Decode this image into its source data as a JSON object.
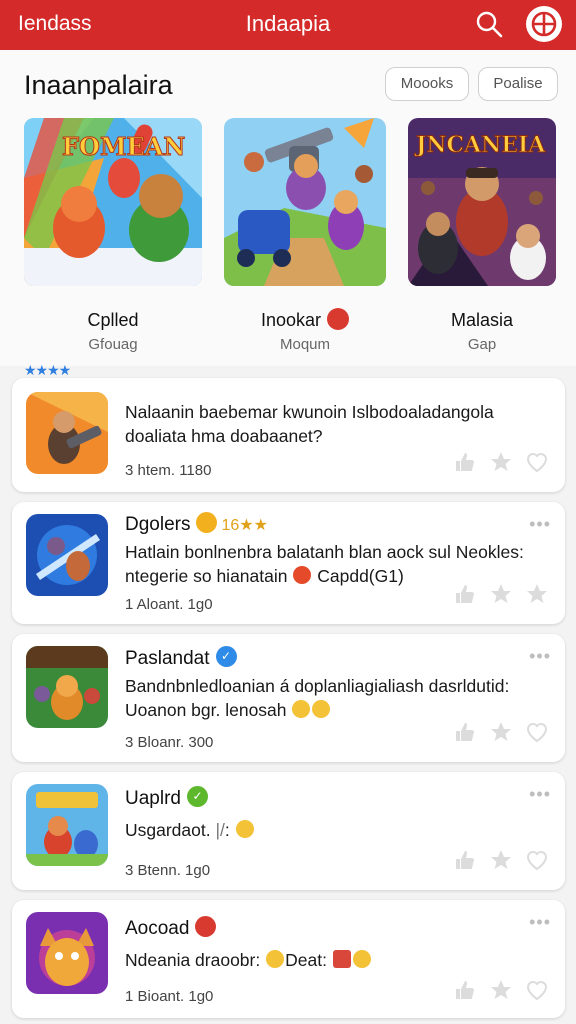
{
  "topbar": {
    "left_label": "Iendass",
    "title": "Indaapia",
    "bg_color": "#d42a2a"
  },
  "header": {
    "title": "Inaanpalaira",
    "pill_1": "Moooks",
    "pill_2": "Poalise"
  },
  "featured": [
    {
      "art_text": "FOMEAN",
      "name": "Cplled",
      "sub": "Gfouag"
    },
    {
      "art_text": "",
      "name": "Inookar",
      "sub": "Moqum"
    },
    {
      "art_text": "JNCANEIA",
      "name": "Malasia",
      "sub": "Gap"
    }
  ],
  "stars_row": "★★★★",
  "cards": [
    {
      "title": "",
      "body_1": "Nalaanin baebemar kwunoin Islbodoaladangola",
      "body_2": "doaliata hma doabaanet?",
      "meta": "3 htem. 1180",
      "more": ""
    },
    {
      "title": "Dgolers",
      "title_extra": "16★★",
      "body_1": "Hatlain bonlnenbra balatanh blan aock sul Neokles:",
      "body_2": "ntegerie so hianatain",
      "body_2b": "Capdd(G1)",
      "meta": "1 Aloant. 1g0",
      "more": "•••"
    },
    {
      "title": "Paslandat",
      "body_1": "Bandnbnledloanian á doplanliagialiash dasrldutid:",
      "body_2": "Uoanon bgr. lenosah",
      "meta": "3 Bloanr. 300",
      "more": "•••"
    },
    {
      "title": "Uaplrd",
      "body_1": "Usgardaot. ",
      "body_1b": ":",
      "meta": "3 Btenn. 1g0",
      "more": "•••"
    },
    {
      "title": "Aocoad",
      "body_1": "Ndeania draoobr:",
      "body_1b": "Deat:",
      "meta": "1 Bioant. 1g0",
      "more": "•••"
    }
  ],
  "icons": {
    "search": "search-icon",
    "globe": "globe-icon",
    "like": "thumb-up-icon",
    "star": "star-icon",
    "heart": "heart-icon"
  }
}
